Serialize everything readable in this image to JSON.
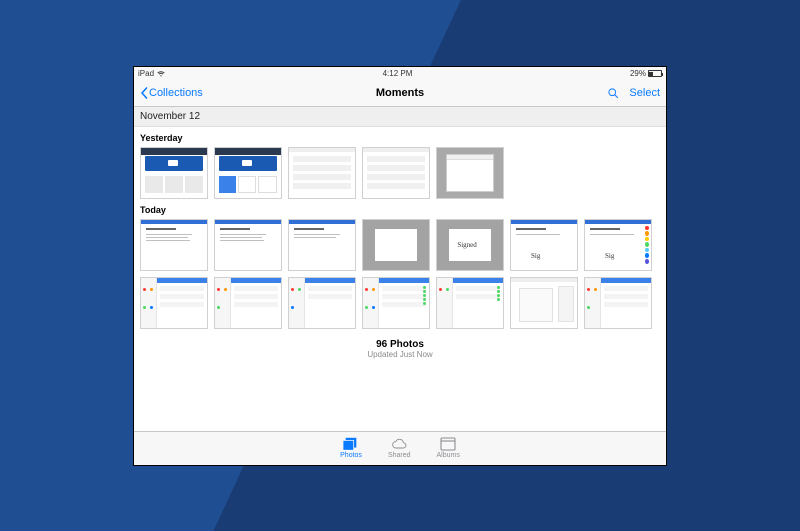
{
  "status": {
    "device": "iPad",
    "time": "4:12 PM",
    "battery_pct": "29%"
  },
  "nav": {
    "back_label": "Collections",
    "title": "Moments",
    "select_label": "Select"
  },
  "section_date": "November 12",
  "groups": {
    "yesterday_label": "Yesterday",
    "today_label": "Today"
  },
  "footer": {
    "count": "96 Photos",
    "updated": "Updated Just Now"
  },
  "tabs": {
    "photos": "Photos",
    "shared": "Shared",
    "albums": "Albums"
  },
  "colors": {
    "accent": "#0a7aff"
  }
}
